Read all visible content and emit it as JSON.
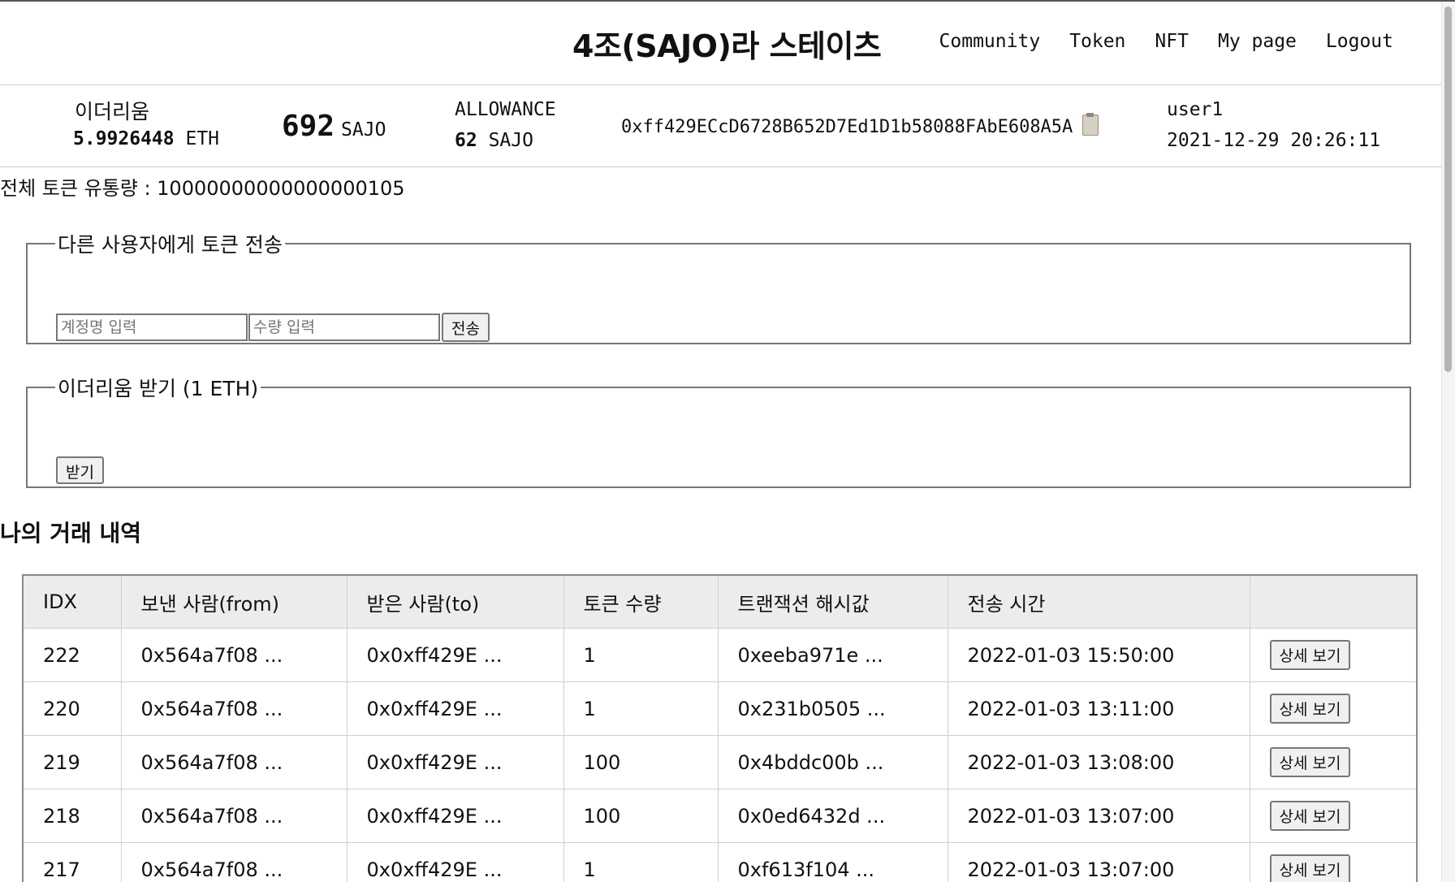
{
  "header": {
    "title": "4조(SAJO)라 스테이츠",
    "nav": [
      "Community",
      "Token",
      "NFT",
      "My page",
      "Logout"
    ]
  },
  "wallet": {
    "eth_label": "이더리움",
    "eth_amount": "5.9926448",
    "eth_unit": "ETH",
    "sajo_balance": "692",
    "sajo_unit": "SAJO",
    "allowance_label": "ALLOWANCE",
    "allowance_amount": "62",
    "allowance_unit": "SAJO",
    "address": "0xff429ECcD6728B652D7Ed1D1b58088FAbE608A5A",
    "user_name": "user1",
    "login_time": "2021-12-29 20:26:11"
  },
  "supply_text": "전체 토큰 유통량 : 10000000000000000105",
  "transfer": {
    "legend": "다른 사용자에게 토큰 전송",
    "account_placeholder": "계정명 입력",
    "amount_placeholder": "수량 입력",
    "send_label": "전송"
  },
  "faucet": {
    "legend": "이더리움 받기 (1 ETH)",
    "receive_label": "받기"
  },
  "history": {
    "title": "나의 거래 내역",
    "columns": [
      "IDX",
      "보낸 사람(from)",
      "받은 사람(to)",
      "토큰 수량",
      "트랜잭션 해시값",
      "전송 시간",
      ""
    ],
    "detail_label": "상세 보기",
    "rows": [
      {
        "idx": "222",
        "from": "0x564a7f08 ...",
        "to": "0x0xff429E ...",
        "amount": "1",
        "hash": "0xeeba971e ...",
        "time": "2022-01-03 15:50:00"
      },
      {
        "idx": "220",
        "from": "0x564a7f08 ...",
        "to": "0x0xff429E ...",
        "amount": "1",
        "hash": "0x231b0505 ...",
        "time": "2022-01-03 13:11:00"
      },
      {
        "idx": "219",
        "from": "0x564a7f08 ...",
        "to": "0x0xff429E ...",
        "amount": "100",
        "hash": "0x4bddc00b ...",
        "time": "2022-01-03 13:08:00"
      },
      {
        "idx": "218",
        "from": "0x564a7f08 ...",
        "to": "0x0xff429E ...",
        "amount": "100",
        "hash": "0x0ed6432d ...",
        "time": "2022-01-03 13:07:00"
      },
      {
        "idx": "217",
        "from": "0x564a7f08 ...",
        "to": "0x0xff429E ...",
        "amount": "1",
        "hash": "0xf613f104 ...",
        "time": "2022-01-03 13:07:00"
      }
    ]
  },
  "icons": {
    "copy": "clipboard-icon"
  }
}
